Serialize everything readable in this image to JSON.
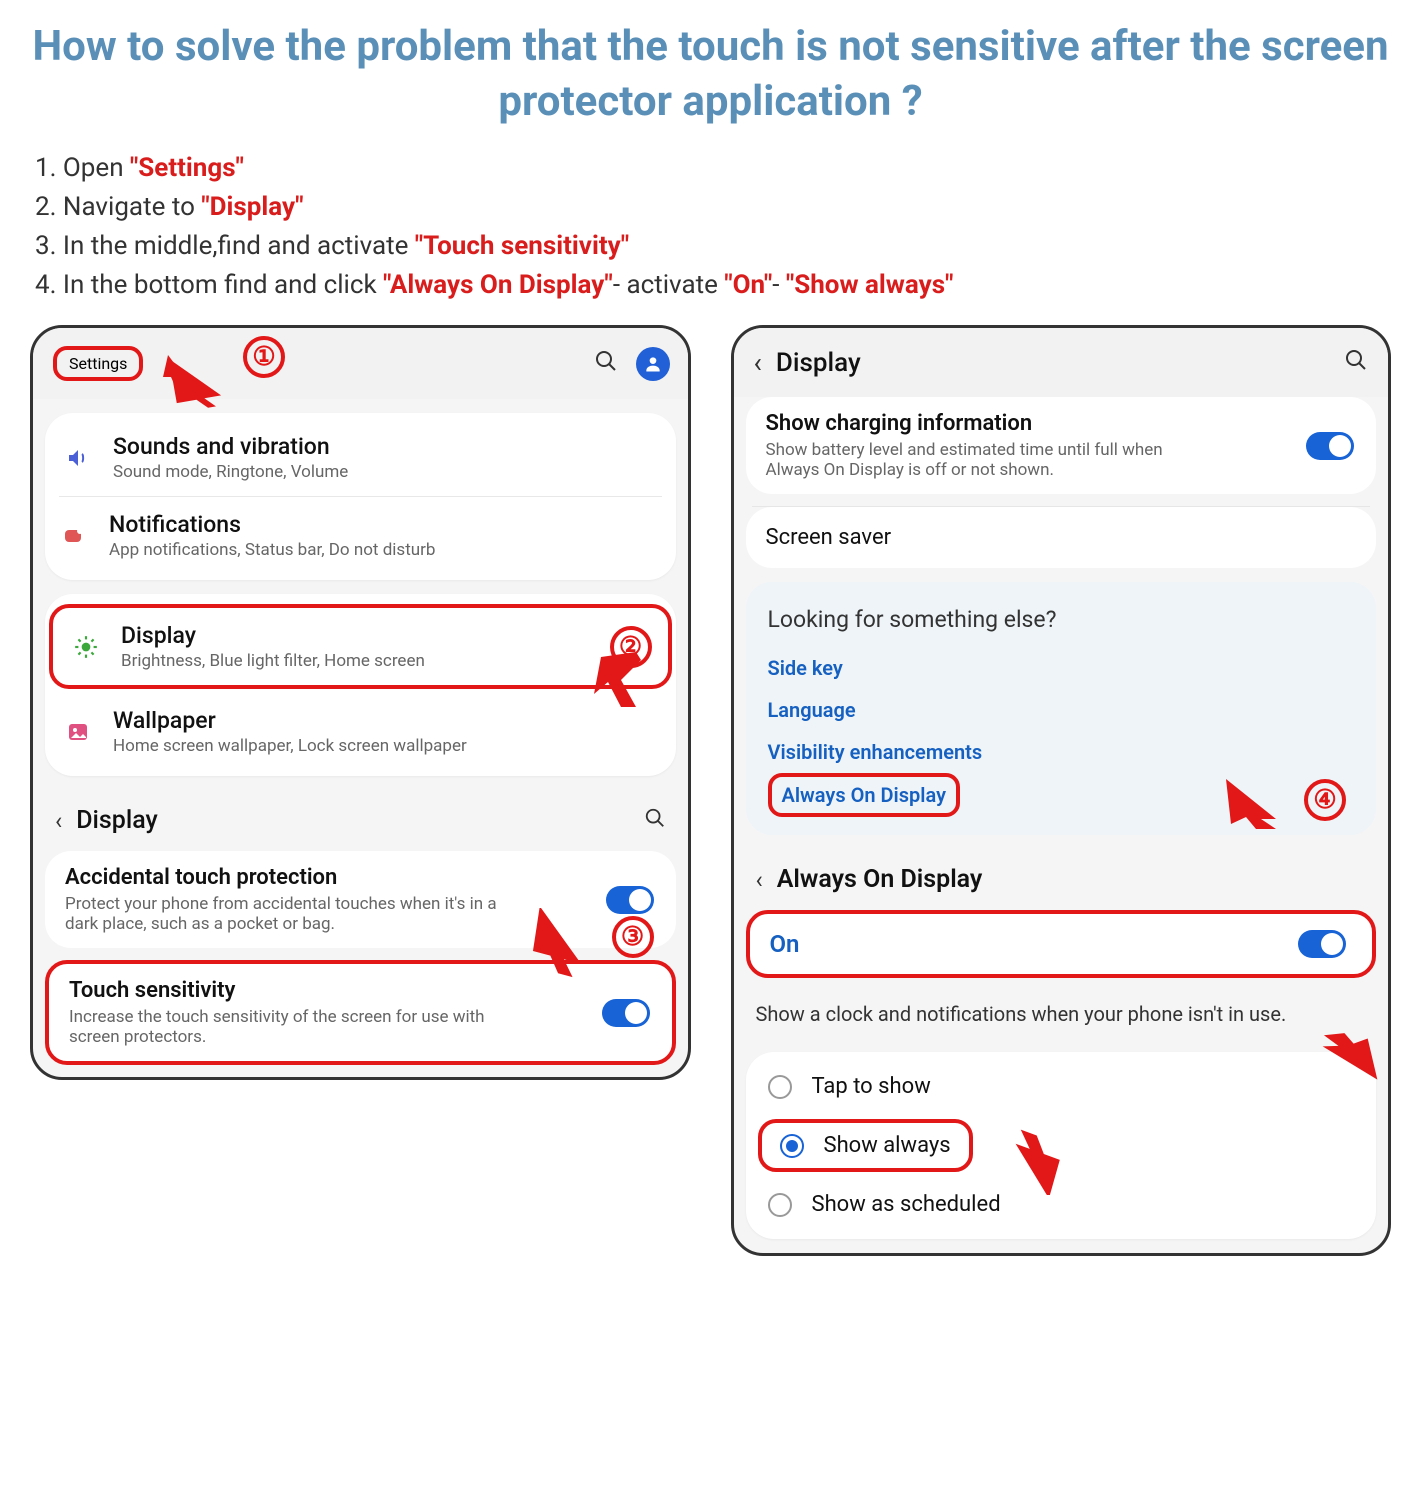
{
  "title": "How to solve the problem that the touch is not sensitive after  the screen protector application ?",
  "steps": {
    "s1_pre": "1. Open ",
    "s1_red": "\"Settings\"",
    "s2_pre": "2. Navigate to ",
    "s2_red": "\"Display\"",
    "s3_pre": "3. In the middle,find and activate ",
    "s3_red": "\"Touch sensitivity\"",
    "s4_pre": "4. In the bottom find and click ",
    "s4_red1": "\"Always On Display\"",
    "s4_mid": "- activate ",
    "s4_red2": "\"On\"",
    "s4_dash": "- ",
    "s4_red3": "\"Show always\""
  },
  "badges": {
    "b1": "①",
    "b2": "②",
    "b3": "③",
    "b4": "④"
  },
  "left": {
    "settings_title": "Settings",
    "rows": [
      {
        "title": "Sounds and vibration",
        "sub": "Sound mode, Ringtone, Volume"
      },
      {
        "title": "Notifications",
        "sub": "App notifications, Status bar, Do not disturb"
      },
      {
        "title": "Display",
        "sub": "Brightness, Blue light filter, Home screen"
      },
      {
        "title": "Wallpaper",
        "sub": "Home screen wallpaper, Lock screen wallpaper"
      }
    ],
    "display_header": "Display",
    "accidental": {
      "title": "Accidental touch protection",
      "sub": "Protect your phone from accidental touches when it's in a dark place, such as a pocket or bag."
    },
    "touchsens": {
      "title": "Touch sensitivity",
      "sub": "Increase the touch sensitivity of the screen for use with screen protectors."
    }
  },
  "right": {
    "header": "Display",
    "charging": {
      "title": "Show charging information",
      "sub": "Show battery level and estimated time until full when Always On Display is off or not shown."
    },
    "screensaver": "Screen saver",
    "looking_title": "Looking for something else?",
    "links": [
      "Side key",
      "Language",
      "Visibility enhancements",
      "Always On Display"
    ],
    "aod_header": "Always On Display",
    "on_label": "On",
    "info": "Show a clock and notifications when your phone isn't in use.",
    "radios": [
      "Tap to show",
      "Show always",
      "Show as scheduled"
    ]
  }
}
